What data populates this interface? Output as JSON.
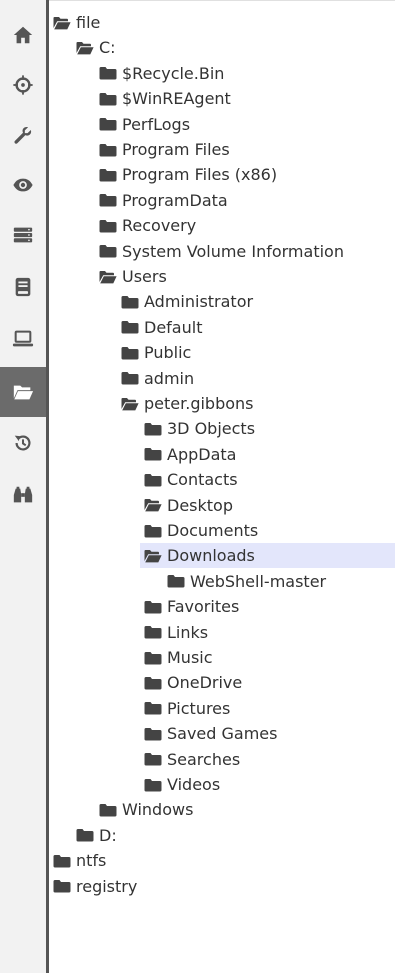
{
  "rail": {
    "items": [
      {
        "icon": "home-icon"
      },
      {
        "icon": "crosshair-icon"
      },
      {
        "icon": "wrench-icon"
      },
      {
        "icon": "eye-icon"
      },
      {
        "icon": "storage-icon"
      },
      {
        "icon": "book-icon"
      },
      {
        "icon": "laptop-icon"
      },
      {
        "icon": "folder-open-icon",
        "active": true
      },
      {
        "icon": "history-icon"
      },
      {
        "icon": "binoculars-icon"
      }
    ]
  },
  "tree": {
    "nodes": [
      {
        "label": "file",
        "depth": 0,
        "open": true
      },
      {
        "label": "C:",
        "depth": 1,
        "open": true
      },
      {
        "label": "$Recycle.Bin",
        "depth": 2
      },
      {
        "label": "$WinREAgent",
        "depth": 2
      },
      {
        "label": "PerfLogs",
        "depth": 2
      },
      {
        "label": "Program Files",
        "depth": 2
      },
      {
        "label": "Program Files (x86)",
        "depth": 2
      },
      {
        "label": "ProgramData",
        "depth": 2
      },
      {
        "label": "Recovery",
        "depth": 2
      },
      {
        "label": "System Volume Information",
        "depth": 2
      },
      {
        "label": "Users",
        "depth": 2,
        "open": true
      },
      {
        "label": "Administrator",
        "depth": 3
      },
      {
        "label": "Default",
        "depth": 3
      },
      {
        "label": "Public",
        "depth": 3
      },
      {
        "label": "admin",
        "depth": 3
      },
      {
        "label": "peter.gibbons",
        "depth": 3,
        "open": true
      },
      {
        "label": "3D Objects",
        "depth": 4
      },
      {
        "label": "AppData",
        "depth": 4
      },
      {
        "label": "Contacts",
        "depth": 4
      },
      {
        "label": "Desktop",
        "depth": 4,
        "open": true
      },
      {
        "label": "Documents",
        "depth": 4
      },
      {
        "label": "Downloads",
        "depth": 4,
        "open": true,
        "selected": true
      },
      {
        "label": "WebShell-master",
        "depth": 5
      },
      {
        "label": "Favorites",
        "depth": 4
      },
      {
        "label": "Links",
        "depth": 4
      },
      {
        "label": "Music",
        "depth": 4
      },
      {
        "label": "OneDrive",
        "depth": 4
      },
      {
        "label": "Pictures",
        "depth": 4
      },
      {
        "label": "Saved Games",
        "depth": 4
      },
      {
        "label": "Searches",
        "depth": 4
      },
      {
        "label": "Videos",
        "depth": 4
      },
      {
        "label": "Windows",
        "depth": 2
      },
      {
        "label": "D:",
        "depth": 1
      },
      {
        "label": "ntfs",
        "depth": 0
      },
      {
        "label": "registry",
        "depth": 0
      }
    ]
  },
  "colors": {
    "rail_bg": "#f2f2f2",
    "rail_active": "#6b6b6b",
    "selected_row": "#e3e6fb",
    "icon": "#444444"
  }
}
